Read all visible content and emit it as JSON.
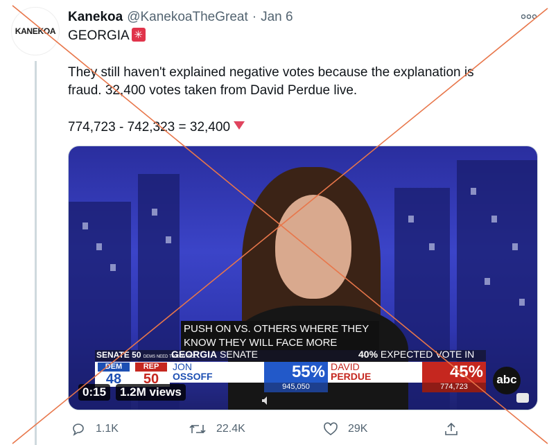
{
  "tweet": {
    "avatar_text": "KANEKOA",
    "display_name": "Kanekoa",
    "handle": "@KanekoaTheGreat",
    "separator": "·",
    "date": "Jan 6",
    "lines": [
      "GEORGIA",
      "They still haven't explained negative votes because the explanation is",
      "fraud. 32,400 votes taken from David Perdue live.",
      "774,723 - 742,323 = 32,400"
    ],
    "emoji_icons": [
      "rotating-light-icon",
      "down-triangle-icon"
    ]
  },
  "video": {
    "caption_line1": "PUSH ON VS. OTHERS WHERE THEY",
    "caption_line2": "KNOW THEY WILL FACE MORE",
    "senate_label": "SENATE",
    "seats_needed": "50",
    "seats_note": "DEMS NEED TO CONTROL",
    "race_title_bold": "GEORGIA",
    "race_title_rest": " SENATE",
    "expected_pct": "40%",
    "expected_label": " EXPECTED VOTE IN",
    "dem_label": "DEM",
    "dem_seats": "48",
    "rep_label": "REP",
    "rep_seats": "50",
    "dem_first": "JON",
    "dem_last": "OSSOFF",
    "dem_pct": "55%",
    "dem_votes": "945,050",
    "rep_first": "DAVID",
    "rep_last": "PERDUE",
    "rep_pct": "45%",
    "rep_votes": "774,723",
    "network": "abc",
    "duration": "0:15",
    "views": "1.2M views",
    "colors": {
      "dem": "#2259c9",
      "rep": "#c5271f",
      "background": "#3b44c8"
    }
  },
  "actions": {
    "reply_count": "1.1K",
    "retweet_count": "22.4K",
    "like_count": "29K",
    "icons": [
      "reply-icon",
      "retweet-icon",
      "like-icon",
      "share-icon"
    ]
  },
  "overlay": {
    "cross_color": "#e8764a"
  }
}
